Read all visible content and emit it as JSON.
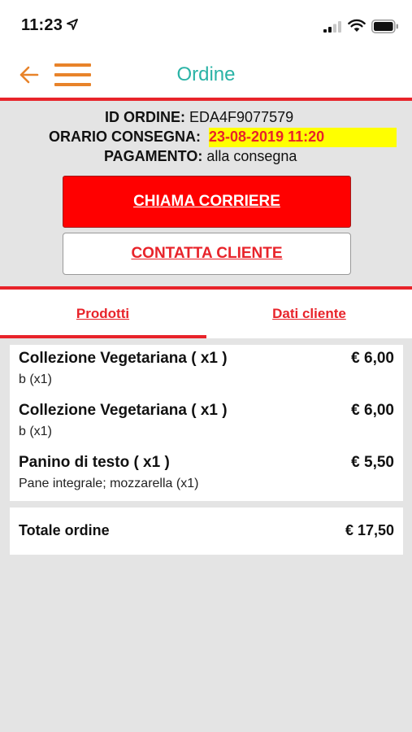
{
  "status_bar": {
    "time": "11:23",
    "icons": [
      "location-arrow-icon",
      "signal-icon",
      "wifi-icon",
      "battery-icon"
    ]
  },
  "nav": {
    "title": "Ordine",
    "back_icon": "arrow-left-icon",
    "menu_icon": "hamburger-menu-icon",
    "title_color": "#2ab3a6",
    "icon_color": "#e8832a"
  },
  "order": {
    "id_label": "ID ORDINE:",
    "id_value": "EDA4F9077579",
    "delivery_label": "ORARIO CONSEGNA:",
    "delivery_value": "23-08-2019 11:20",
    "payment_label": "PAGAMENTO:",
    "payment_value": "alla consegna"
  },
  "actions": {
    "call_courier": "CHIAMA CORRIERE",
    "contact_customer": "CONTATTA CLIENTE"
  },
  "tabs": [
    {
      "label": "Prodotti",
      "active": true
    },
    {
      "label": "Dati cliente",
      "active": false
    }
  ],
  "products": [
    {
      "name": "Collezione Vegetariana ( x1 )",
      "detail": "b (x1)",
      "price": "€ 6,00"
    },
    {
      "name": "Collezione Vegetariana ( x1 )",
      "detail": "b (x1)",
      "price": "€ 6,00"
    },
    {
      "name": "Panino di testo ( x1 )",
      "detail": "Pane integrale; mozzarella (x1)",
      "price": "€ 5,50"
    }
  ],
  "total": {
    "label": "Totale ordine",
    "value": "€ 17,50"
  },
  "colors": {
    "accent_red": "#e8232a",
    "button_red": "#ff0000",
    "highlight_yellow": "#ffff00",
    "background": "#e4e4e4"
  }
}
